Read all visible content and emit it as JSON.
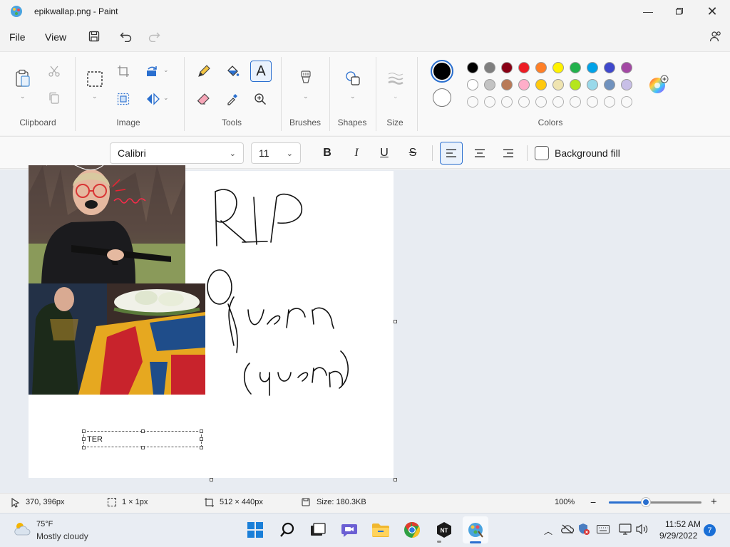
{
  "window": {
    "title": "epikwallap.png - Paint"
  },
  "menu": {
    "file": "File",
    "view": "View"
  },
  "ribbon": {
    "groups": {
      "clipboard": "Clipboard",
      "image": "Image",
      "tools": "Tools",
      "brushes": "Brushes",
      "shapes": "Shapes",
      "size": "Size",
      "colors": "Colors"
    },
    "palette_row1": [
      "#000000",
      "#7f7f7f",
      "#880015",
      "#ed1c24",
      "#ff7f27",
      "#fff200",
      "#22b14c",
      "#00a2e8",
      "#3f48cc",
      "#a349a4"
    ],
    "palette_row2": [
      "#ffffff",
      "#c3c3c3",
      "#b97a57",
      "#ffaec9",
      "#ffc90e",
      "#efe4b0",
      "#b5e61d",
      "#99d9ea",
      "#7092be",
      "#c8bfe7"
    ],
    "primary_color": "#000000",
    "secondary_color": "#ffffff"
  },
  "textbar": {
    "font": "Calibri",
    "size": "11",
    "bold": "B",
    "italic": "I",
    "underline": "U",
    "strike": "S",
    "background_fill": "Background fill"
  },
  "canvas": {
    "textbox_text": "TER"
  },
  "status": {
    "cursor": "370, 396px",
    "selection": "1 × 1px",
    "canvas_size": "512 × 440px",
    "file_size": "Size: 180.3KB",
    "zoom": "100%",
    "zoom_level": 0.4
  },
  "taskbar": {
    "weather_temp": "75°F",
    "weather_desc": "Mostly cloudy",
    "time": "11:52 AM",
    "date": "9/29/2022",
    "notif_count": "7"
  }
}
